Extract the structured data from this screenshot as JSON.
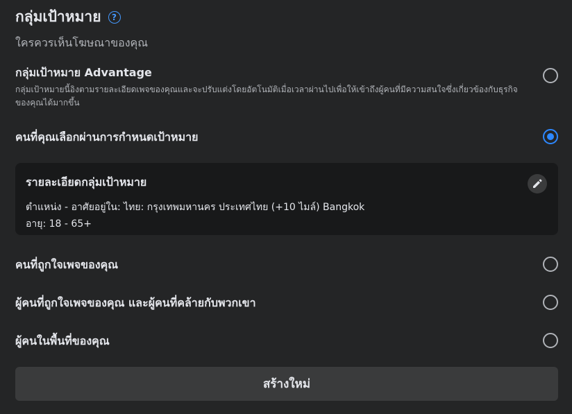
{
  "header": {
    "title": "กลุ่มเป้าหมาย",
    "help_icon": "question-circle-icon",
    "subtitle": "ใครควรเห็นโฆษณาของคุณ"
  },
  "options": [
    {
      "label": "กลุ่มเป้าหมาย Advantage",
      "description": "กลุ่มเป้าหมายนี้อิงตามรายละเอียดเพจของคุณและจะปรับแต่งโดยอัตโนมัติเมื่อเวลาผ่านไปเพื่อให้เข้าถึงผู้คนที่มีความสนใจซึ่งเกี่ยวข้องกับธุรกิจของคุณได้มากขึ้น",
      "selected": false
    },
    {
      "label": "คนที่คุณเลือกผ่านการกำหนดเป้าหมาย",
      "selected": true
    },
    {
      "label": "คนที่ถูกใจเพจของคุณ",
      "selected": false
    },
    {
      "label": "ผู้คนที่ถูกใจเพจของคุณ และผู้คนที่คล้ายกับพวกเขา",
      "selected": false
    },
    {
      "label": "ผู้คนในพื้นที่ของคุณ",
      "selected": false
    }
  ],
  "detail": {
    "title": "รายละเอียดกลุ่มเป้าหมาย",
    "location": "ตำแหน่ง - อาศัยอยู่ใน: ไทย: กรุงเทพมหานคร ประเทศไทย (+10 ไมล์) Bangkok",
    "age": "อายุ: 18 - 65+",
    "edit_icon": "pencil-icon"
  },
  "create_button": "สร้างใหม่",
  "colors": {
    "background": "#242526",
    "card": "#18191a",
    "accent": "#2d88ff",
    "button": "#3a3b3c"
  }
}
